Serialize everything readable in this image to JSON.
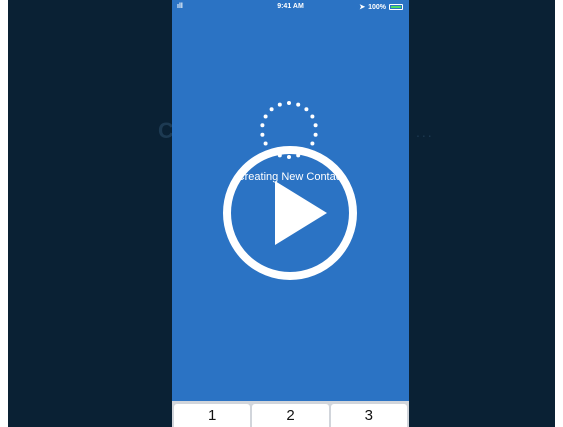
{
  "background_text": {
    "left": "C",
    "right": "..."
  },
  "status_bar": {
    "time": "9:41 AM",
    "battery_percent": "100%",
    "signal": "ıll",
    "location_icon": "location-arrow-icon"
  },
  "loading": {
    "text": "Creating New Contact"
  },
  "keypad": {
    "keys": [
      "1",
      "2",
      "3"
    ]
  },
  "play_button": {
    "icon": "play-icon"
  },
  "colors": {
    "screen_blue": "#2b73c4",
    "frame_dark": "#0a2134",
    "battery_green": "#4cd964"
  }
}
